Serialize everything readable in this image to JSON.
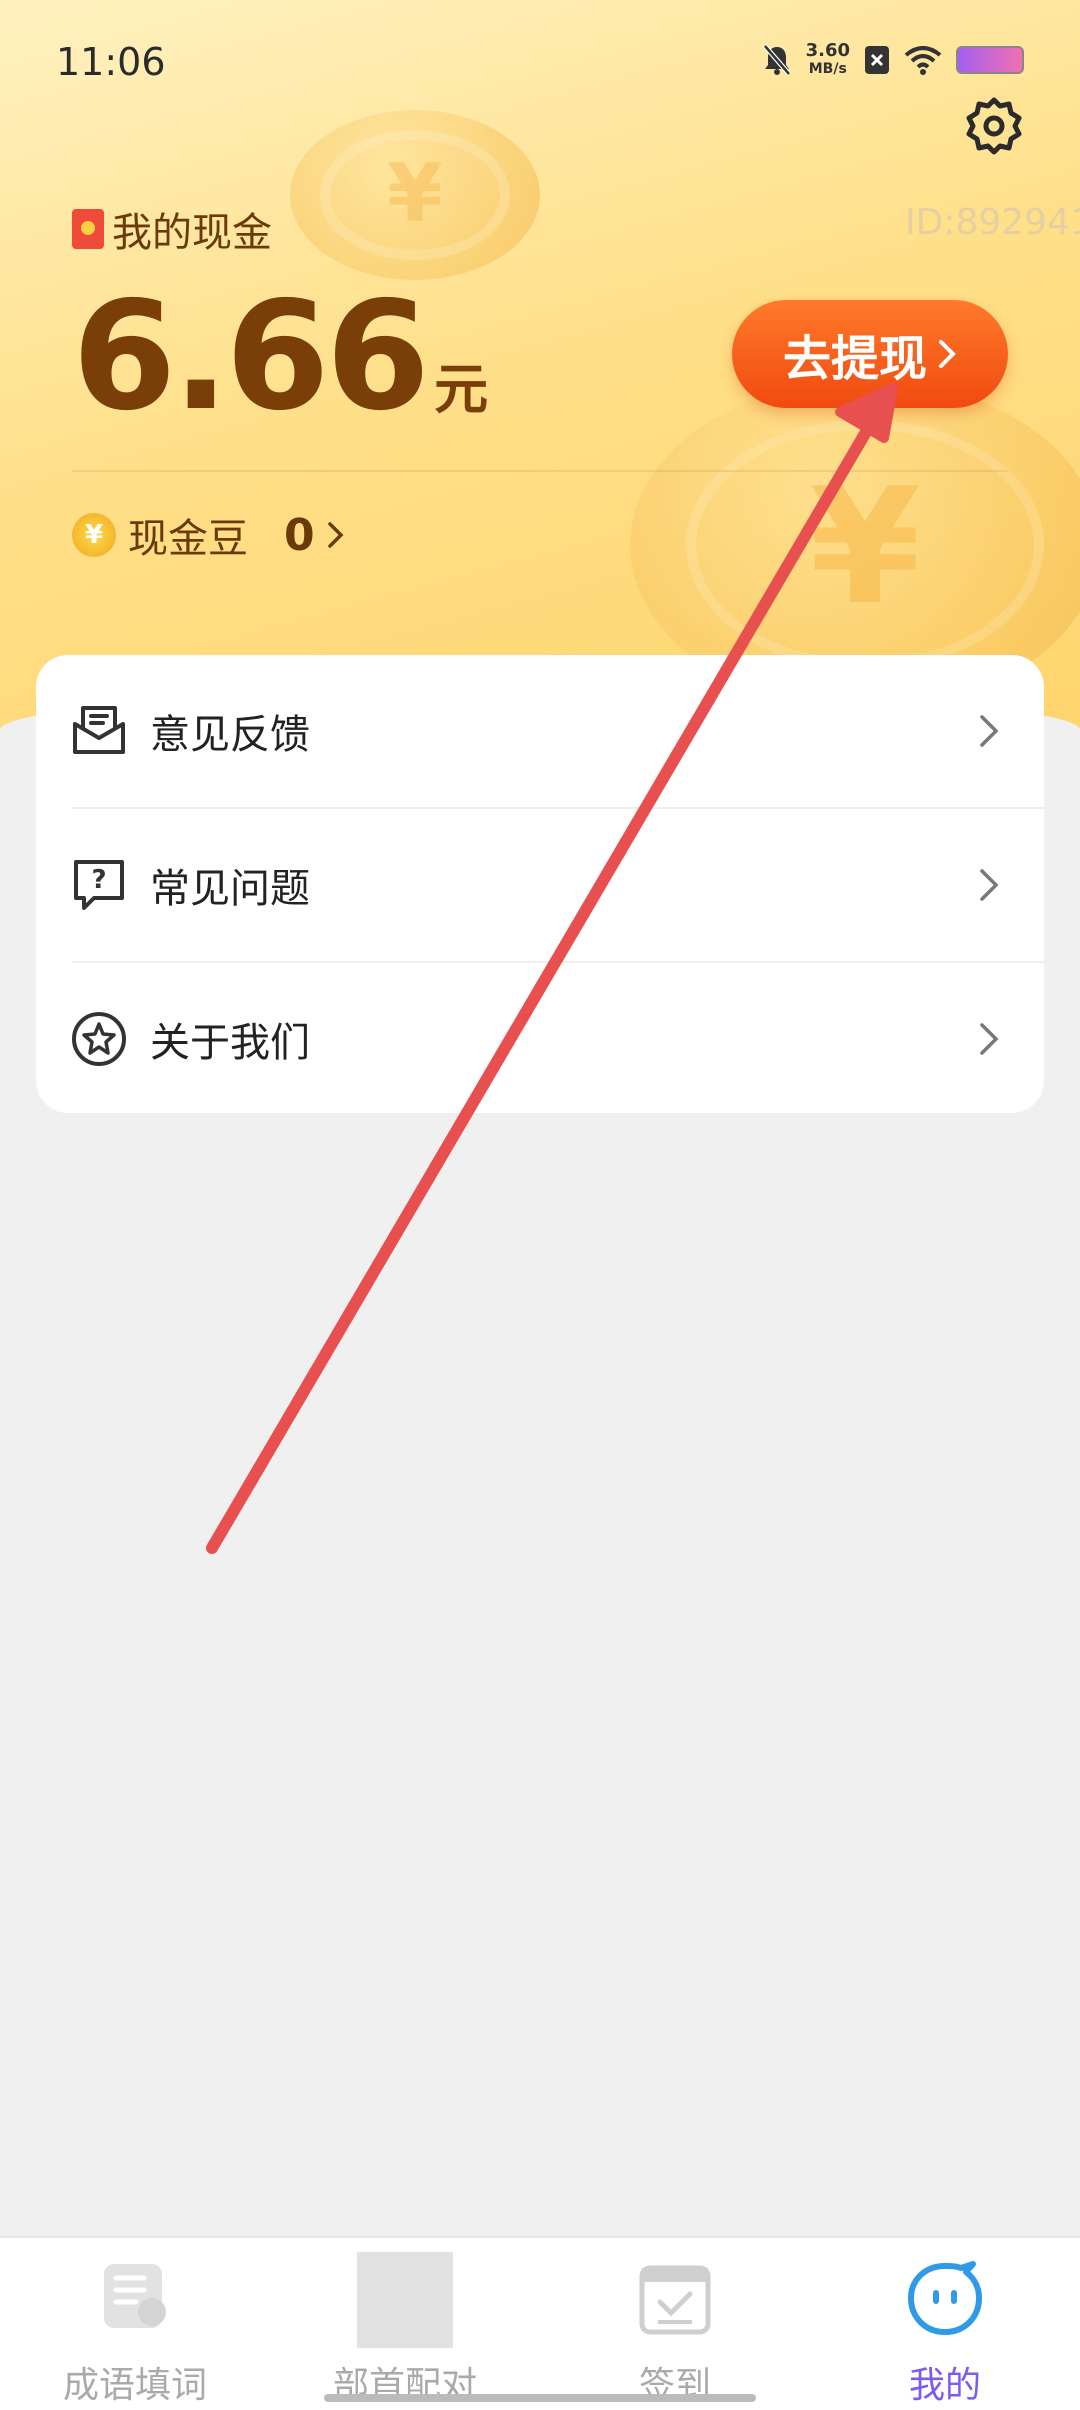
{
  "status_bar": {
    "time": "11:06",
    "speed_value": "3.60",
    "speed_unit": "MB/s"
  },
  "header": {
    "cash_label": "我的现金",
    "user_id": "ID:892941",
    "amount": "6.66",
    "unit": "元",
    "withdraw_label": "去提现",
    "beans_label": "现金豆",
    "beans_count": "0"
  },
  "menu": {
    "items": [
      {
        "label": "意见反馈",
        "icon": "feedback-envelope-icon"
      },
      {
        "label": "常见问题",
        "icon": "question-bubble-icon"
      },
      {
        "label": "关于我们",
        "icon": "star-circle-icon"
      }
    ]
  },
  "tabbar": {
    "tabs": [
      {
        "label": "成语填词",
        "icon": "idiom-book-icon",
        "active": false
      },
      {
        "label": "部首配对",
        "icon": "radical-placeholder-icon",
        "active": false
      },
      {
        "label": "签到",
        "icon": "calendar-check-icon",
        "active": false
      },
      {
        "label": "我的",
        "icon": "smiley-face-icon",
        "active": true
      }
    ]
  },
  "colors": {
    "accent": "#f04a10",
    "text_brown": "#7a3e08",
    "tab_active": "#7a5cf0",
    "annotation_arrow": "#e8504f"
  }
}
